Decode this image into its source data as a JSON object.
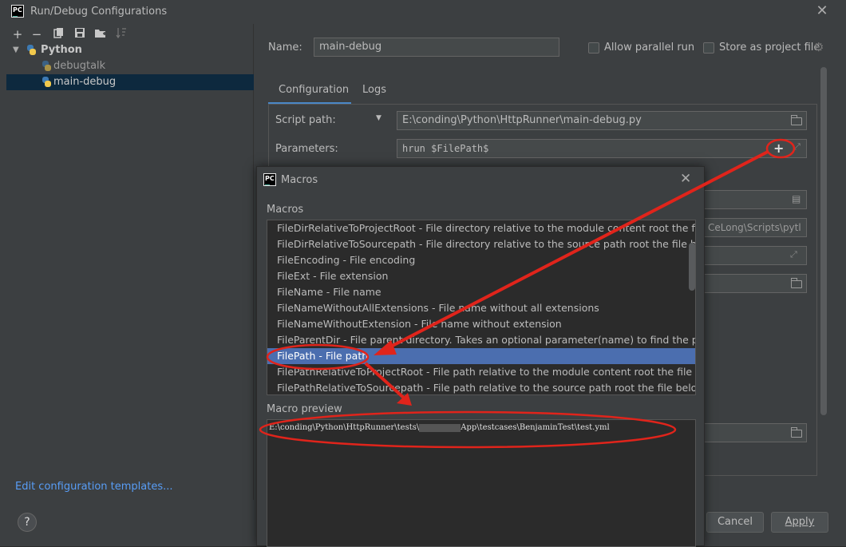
{
  "window": {
    "title": "Run/Debug Configurations",
    "logo_text": "PC"
  },
  "toolbar": {
    "icons": [
      "add-icon",
      "remove-icon",
      "copy-icon",
      "save-icon",
      "folder-add-icon",
      "sort-icon"
    ]
  },
  "tree": {
    "group": "Python",
    "items": [
      "debugtalk",
      "main-debug"
    ],
    "selected": "main-debug"
  },
  "left_footer": {
    "edit_link": "Edit configuration templates...",
    "help": "?"
  },
  "form": {
    "name_label": "Name:",
    "name_value": "main-debug",
    "allow_parallel": "Allow parallel run",
    "store_project": "Store as project file",
    "tabs": [
      "Configuration",
      "Logs"
    ],
    "script_path_label": "Script path:",
    "script_path_value": "E:\\conding\\Python\\HttpRunner\\main-debug.py",
    "parameters_label": "Parameters:",
    "parameters_value": "hrun $FilePath$",
    "interpreter_partial": "CeLong\\Scripts\\pytl",
    "cancel": "Cancel",
    "apply": "Apply"
  },
  "macros": {
    "title": "Macros",
    "list_label": "Macros",
    "items": [
      "FileDirRelativeToProjectRoot - File directory relative to the module content root the file bel",
      "FileDirRelativeToSourcepath - File directory relative to the source path root the file belong",
      "FileEncoding - File encoding",
      "FileExt - File extension",
      "FileName - File name",
      "FileNameWithoutAllExtensions - File name without all extensions",
      "FileNameWithoutExtension - File name without extension",
      "FileParentDir - File parent directory. Takes an optional parameter(name) to find the parent",
      "FilePath - File path",
      "FilePathRelativeToProjectRoot - File path relative to the module content root the file belong",
      "FilePathRelativeToSourcepath - File path relative to the source path root the file belongs to"
    ],
    "selected_index": 8,
    "preview_label": "Macro preview",
    "preview_prefix": "E:\\conding\\Python\\HttpRunner\\tests\\",
    "preview_suffix": "App\\testcases\\BenjaminTest\\test.yml"
  },
  "colors": {
    "background": "#3c3f41",
    "selection": "#4b6eaf",
    "annotation": "#e0241b",
    "link": "#589df6"
  }
}
